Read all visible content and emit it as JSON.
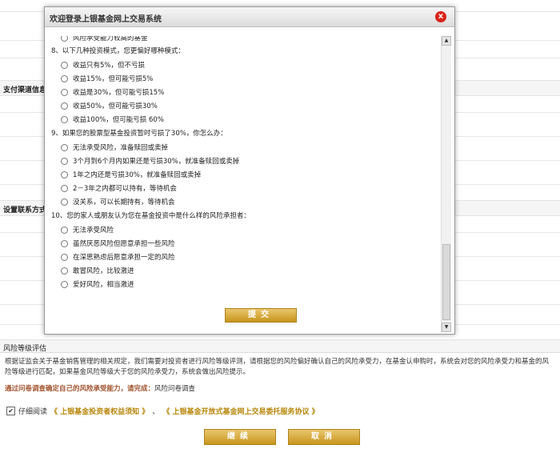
{
  "modal": {
    "title": "欢迎登录上银基金网上交易系统",
    "close": "x",
    "partial_top": "风险承受能力较高的基金",
    "q8": "8、以下几种投资模式，您更偏好哪种模式：",
    "q8_options": [
      "收益只有5%，但不亏损",
      "收益15%，但可能亏损5%",
      "收益是30%，但可能亏损15%",
      "收益50%，但可能亏损30%",
      "收益100%，但可能亏损 60%"
    ],
    "q9": "9、如果您的股票型基金投资暂时亏损了30%，你怎么办：",
    "q9_options": [
      "无法承受风险，准备赎回或卖掉",
      "3个月到6个月内如果还是亏损30%，就准备赎回或卖掉",
      "1年之内还是亏损30%，就准备赎回或卖掉",
      "2－3年之内都可以持有，等待机会",
      "没关系，可以长期持有，等待机会"
    ],
    "q10": "10、您的家人或朋友认为您在基金投资中是什么样的风险承担者：",
    "q10_options": [
      "无法承受风险",
      "虽然厌恶风险但愿意承担一些风险",
      "在深思熟虑后愿意承担一定的风险",
      "敢冒风险，比较激进",
      "爱好风险，相当激进"
    ],
    "submit": "提交"
  },
  "background": {
    "section_payment": "支付渠道信息",
    "section_contact": "设置联系方式",
    "section_risk": "风险等级评估",
    "risk_text": "根据证监会关于基金销售管理的相关规定，我们需要对投资者进行风险等级评测，请根据您的风险偏好确认自己的风险承受力，在基金认申购时，系统会对您的风险承受力和基金的风险等级进行匹配，如果基金风险等级大于您的风险承受力，系统会做出风险提示。",
    "risk_link_prefix": "通过问卷调查确定自己的风险承受能力，请完成：",
    "risk_link": "风险问卷调查",
    "agree_prefix": "仔细阅读",
    "agree_link1": "《 上银基金投资者权益须知 》",
    "agree_sep": "、",
    "agree_link2": "《 上银基金开放式基金网上交易委托服务协议 》",
    "continue": "继续",
    "cancel": "取消"
  }
}
